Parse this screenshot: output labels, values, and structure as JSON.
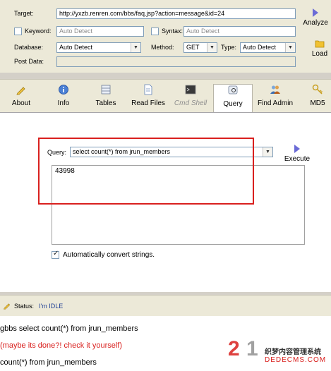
{
  "form": {
    "target_label": "Target:",
    "target_value": "http://yxzb.renren.com/bbs/faq.jsp?action=message&id=24",
    "keyword_label": "Keyword:",
    "keyword_value": "Auto Detect",
    "syntax_label": "Syntax:",
    "syntax_value": "Auto Detect",
    "database_label": "Database:",
    "database_value": "Auto Detect",
    "method_label": "Method:",
    "method_value": "GET",
    "type_label": "Type:",
    "type_value": "Auto Detect",
    "postdata_label": "Post Data:",
    "postdata_value": ""
  },
  "side_buttons": {
    "analyze": "Analyze",
    "load": "Load"
  },
  "toolbar": {
    "about": "About",
    "info": "Info",
    "tables": "Tables",
    "read_files": "Read Files",
    "cmd_shell": "Cmd Shell",
    "query": "Query",
    "find_admin": "Find Admin",
    "md5": "MD5"
  },
  "query": {
    "label": "Query:",
    "value": "select count(*) from  jrun_members",
    "execute": "Execute",
    "result": "43998",
    "auto_convert_label": "Automatically convert strings.",
    "auto_convert_checked": true
  },
  "status": {
    "label": "Status:",
    "value": "I'm IDLE"
  },
  "log": [
    "gbbs select count(*) from  jrun_members",
    "(maybe its done?! check it yourself)",
    "count(*) from  jrun_members"
  ],
  "watermark": {
    "site": "DEDECMS.COM",
    "tagline": "织梦内容管理系统"
  },
  "colors": {
    "accent": "#d9201e",
    "status_text": "#1f3f95",
    "log_warning": "#d9201e"
  }
}
